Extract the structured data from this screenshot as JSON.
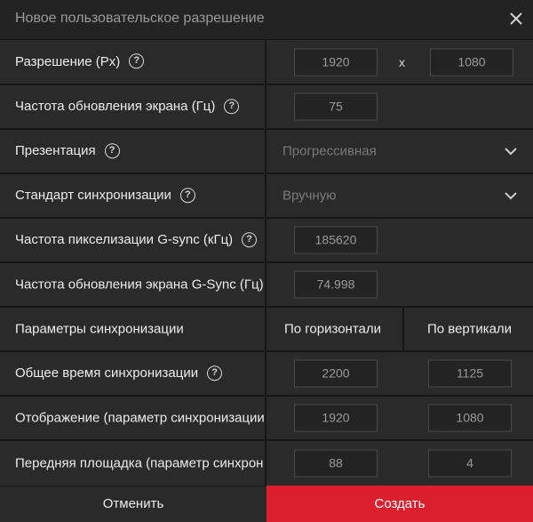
{
  "dialog": {
    "title": "Новое пользовательское разрешение",
    "close_icon": "close-icon"
  },
  "resolution": {
    "label": "Разрешение (Px)",
    "width": "1920",
    "separator": "x",
    "height": "1080"
  },
  "refresh_rate": {
    "label": "Частота обновления экрана (Гц)",
    "value": "75"
  },
  "presentation": {
    "label": "Презентация",
    "selected": "Прогрессивная"
  },
  "timing_standard": {
    "label": "Стандарт синхронизации",
    "selected": "Вручную"
  },
  "gsync_pixel_clock": {
    "label": "Частота пикселизации G-sync (кГц)",
    "value": "185620"
  },
  "gsync_refresh_rate": {
    "label": "Частота обновления экрана G-Sync (Гц)",
    "value": "74.998"
  },
  "timing_params": {
    "label": "Параметры синхронизации",
    "horizontal": "По горизонтали",
    "vertical": "По вертикали"
  },
  "total_timing": {
    "label": "Общее время синхронизации",
    "horizontal": "2200",
    "vertical": "1125"
  },
  "display": {
    "label": "Отображение (параметр синхронизации",
    "horizontal": "1920",
    "vertical": "1080"
  },
  "front_porch": {
    "label": "Передняя площадка (параметр синхрон",
    "horizontal": "88",
    "vertical": "4"
  },
  "footer": {
    "cancel": "Отменить",
    "create": "Создать"
  },
  "colors": {
    "accent": "#dc1f2e",
    "background": "#2a2a2a",
    "titlebar": "#232323"
  }
}
